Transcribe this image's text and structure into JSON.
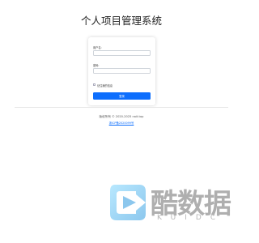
{
  "header": {
    "title": "个人项目管理系统"
  },
  "login_form": {
    "username_label": "用户名:",
    "username_value": "",
    "password_label": "密码:",
    "password_value": "",
    "remember_label": "记住我的信息",
    "remember_checked": false,
    "submit_label": "登录"
  },
  "footer": {
    "copyright": "版权所有 © 2020-2025 nait.top",
    "icp": "浙ICP备2020099号"
  },
  "watermark": {
    "name": "酷数据",
    "sub": "KUIDC",
    "icon": "play-icon"
  },
  "colors": {
    "accent": "#0d6efd",
    "watermark_icon_blue": "#4fc3f7"
  }
}
